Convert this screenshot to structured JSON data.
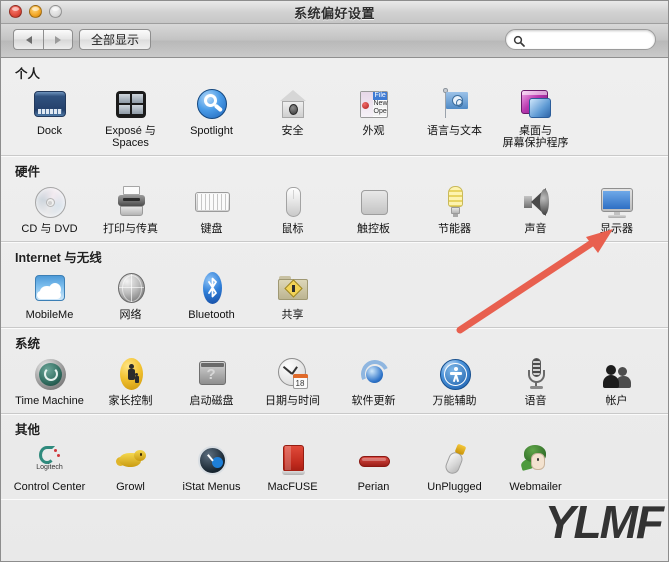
{
  "window": {
    "title": "系统偏好设置",
    "traffic_lights": [
      {
        "name": "close",
        "color": "#e04b3c"
      },
      {
        "name": "minimize",
        "color": "#f2a626"
      },
      {
        "name": "zoom",
        "color": "#dcdcdc"
      }
    ]
  },
  "toolbar": {
    "back_label": "◀",
    "forward_label": "▶",
    "show_all_label": "全部显示",
    "search_placeholder": "",
    "search_value": "",
    "search_icon": "search-icon"
  },
  "annotation": {
    "arrow_color": "#e8604f",
    "arrow_target": "显示器",
    "watermark_text": "YLMF"
  },
  "sections": [
    {
      "title": "个人",
      "items": [
        {
          "label": "Dock",
          "icon": "dock-icon"
        },
        {
          "label": "Exposé 与\nSpaces",
          "icon": "expose-spaces-icon"
        },
        {
          "label": "Spotlight",
          "icon": "spotlight-icon"
        },
        {
          "label": "安全",
          "icon": "security-icon"
        },
        {
          "label": "外观",
          "icon": "appearance-icon"
        },
        {
          "label": "语言与文本",
          "icon": "language-text-icon"
        },
        {
          "label": "桌面与\n屏幕保护程序",
          "icon": "desktop-screensaver-icon"
        }
      ]
    },
    {
      "title": "硬件",
      "items": [
        {
          "label": "CD 与 DVD",
          "icon": "cd-dvd-icon"
        },
        {
          "label": "打印与传真",
          "icon": "print-fax-icon"
        },
        {
          "label": "键盘",
          "icon": "keyboard-icon"
        },
        {
          "label": "鼠标",
          "icon": "mouse-icon"
        },
        {
          "label": "触控板",
          "icon": "trackpad-icon"
        },
        {
          "label": "节能器",
          "icon": "energy-saver-icon"
        },
        {
          "label": "声音",
          "icon": "sound-icon"
        },
        {
          "label": "显示器",
          "icon": "displays-icon"
        }
      ]
    },
    {
      "title": "Internet 与无线",
      "items": [
        {
          "label": "MobileMe",
          "icon": "mobileme-icon"
        },
        {
          "label": "网络",
          "icon": "network-icon"
        },
        {
          "label": "Bluetooth",
          "icon": "bluetooth-icon"
        },
        {
          "label": "共享",
          "icon": "sharing-icon"
        }
      ]
    },
    {
      "title": "系统",
      "items": [
        {
          "label": "Time Machine",
          "icon": "time-machine-icon"
        },
        {
          "label": "家长控制",
          "icon": "parental-controls-icon"
        },
        {
          "label": "启动磁盘",
          "icon": "startup-disk-icon"
        },
        {
          "label": "日期与时间",
          "icon": "date-time-icon"
        },
        {
          "label": "软件更新",
          "icon": "software-update-icon"
        },
        {
          "label": "万能辅助",
          "icon": "universal-access-icon"
        },
        {
          "label": "语音",
          "icon": "speech-icon"
        },
        {
          "label": "帐户",
          "icon": "accounts-icon"
        }
      ]
    },
    {
      "title": "其他",
      "items": [
        {
          "label": "Control Center",
          "icon": "logitech-control-center-icon"
        },
        {
          "label": "Growl",
          "icon": "growl-icon"
        },
        {
          "label": "iStat Menus",
          "icon": "istat-menus-icon"
        },
        {
          "label": "MacFUSE",
          "icon": "macfuse-icon"
        },
        {
          "label": "Perian",
          "icon": "perian-icon"
        },
        {
          "label": "UnPlugged",
          "icon": "unplugged-icon"
        },
        {
          "label": "Webmailer",
          "icon": "webmailer-icon"
        }
      ]
    }
  ],
  "extra_labels": {
    "date_calendar_day": "18",
    "appearance_file": "File",
    "appearance_new": "New",
    "appearance_open": "Ope",
    "startup_disk_mark": "?",
    "logitech_brand": "Logitech"
  }
}
